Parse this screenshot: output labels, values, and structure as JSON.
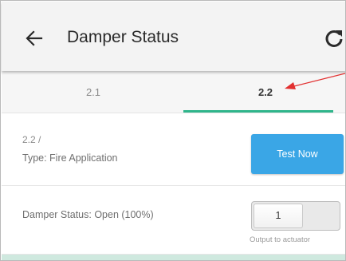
{
  "appbar": {
    "title": "Damper Status",
    "back_icon": "arrow-left-icon",
    "refresh_icon": "refresh-icon"
  },
  "tabs": [
    {
      "label": "2.1",
      "selected": false
    },
    {
      "label": "2.2",
      "selected": true
    }
  ],
  "colors": {
    "accent": "#2fb58b",
    "button": "#3aa6e6",
    "annotation_arrow": "#e23030"
  },
  "type_row": {
    "line1": "2.2 /",
    "line2": "Type: Fire Application",
    "button_label": "Test Now"
  },
  "status_row": {
    "label": "Damper Status:  Open (100%)",
    "switch_value": "1",
    "switch_caption": "Output to actuator"
  }
}
